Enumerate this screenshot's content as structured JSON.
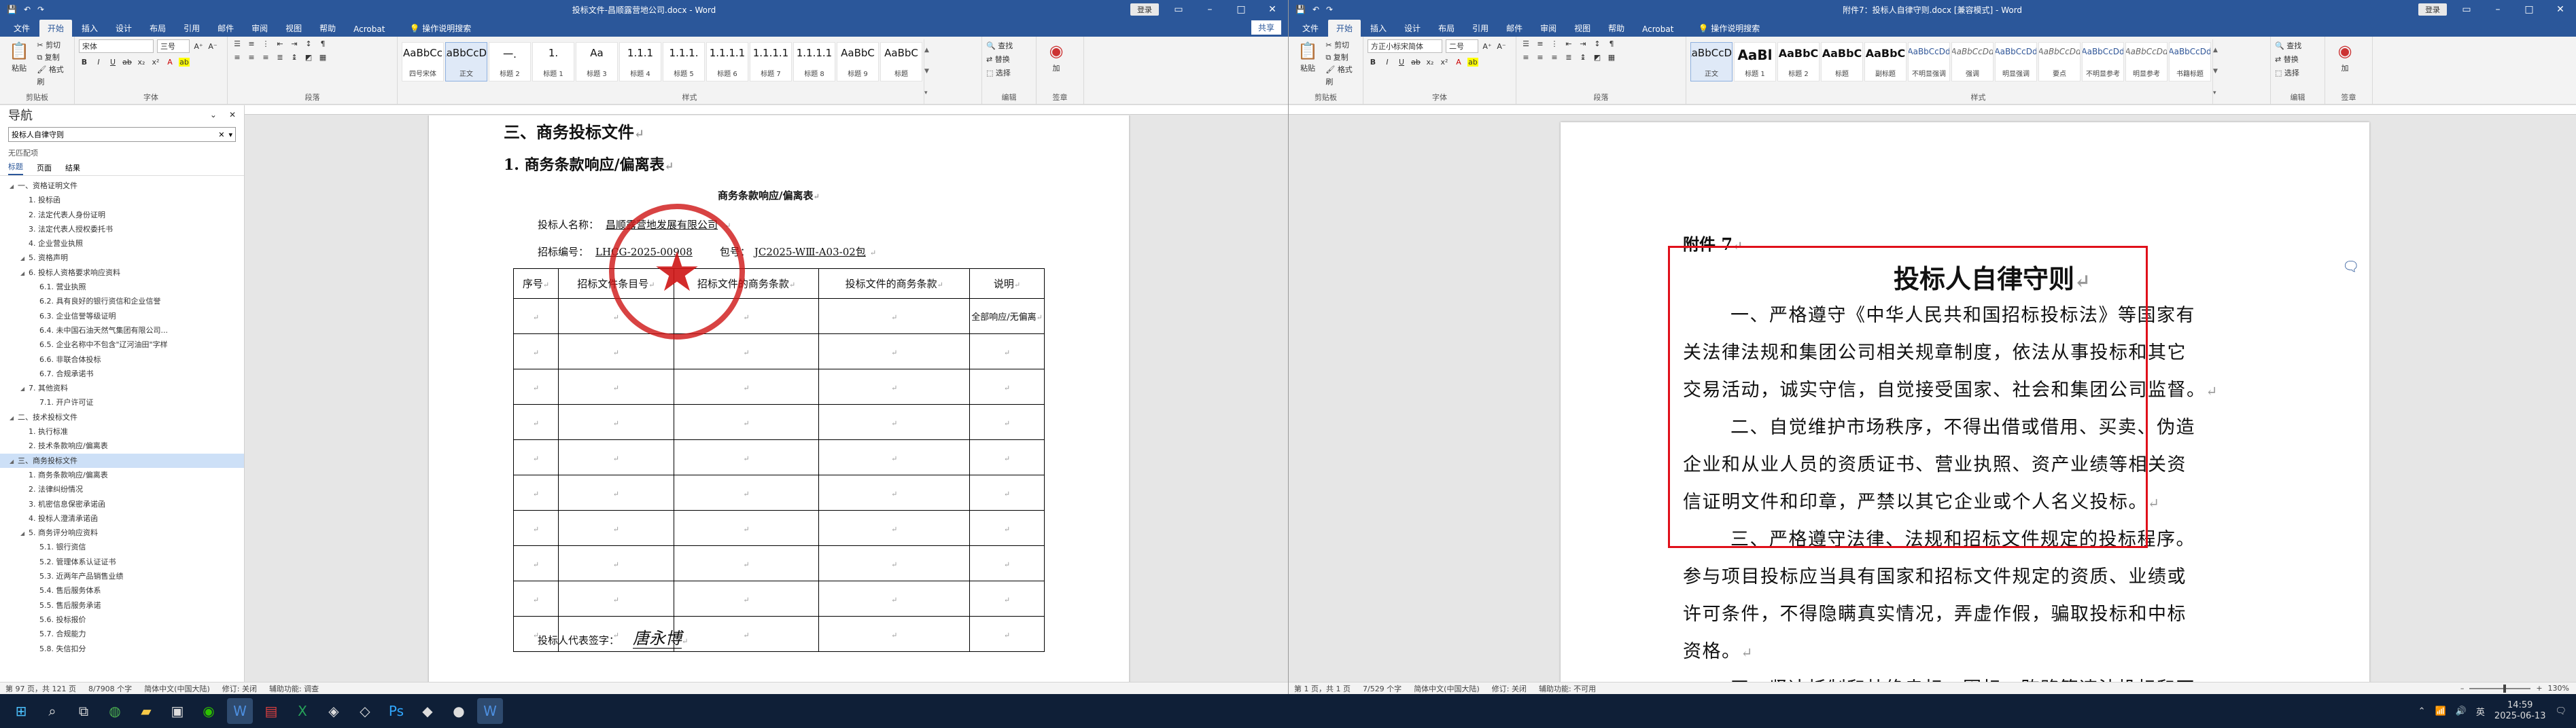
{
  "left": {
    "title": "投标文件-昌顺露营地公司.docx - Word",
    "login": "登录",
    "tabs": [
      "文件",
      "开始",
      "插入",
      "设计",
      "布局",
      "引用",
      "邮件",
      "审阅",
      "视图",
      "帮助",
      "Acrobat"
    ],
    "tell_me": "操作说明搜索",
    "share": "共享",
    "clipboard": {
      "paste": "粘贴",
      "cut": "剪切",
      "copy": "复制",
      "format_painter": "格式刷",
      "label": "剪贴板"
    },
    "font": {
      "name": "宋体",
      "size": "三号",
      "label": "字体"
    },
    "paragraph_label": "段落",
    "styles": [
      {
        "preview": "AaBbCc",
        "name": "四号宋体"
      },
      {
        "preview": "AaBbCcDd",
        "name": "正文"
      },
      {
        "preview": "一.",
        "name": "标题 2"
      },
      {
        "preview": "1.",
        "name": "标题 1"
      },
      {
        "preview": "Aa",
        "name": "标题 3"
      },
      {
        "preview": "1.1.1",
        "name": "标题 4"
      },
      {
        "preview": "1.1.1.",
        "name": "标题 5"
      },
      {
        "preview": "1.1.1.1",
        "name": "标题 6"
      },
      {
        "preview": "1.1.1.1",
        "name": "标题 7"
      },
      {
        "preview": "1.1.1.1",
        "name": "标题 8"
      },
      {
        "preview": "AaBbC",
        "name": "标题 9"
      },
      {
        "preview": "AaBbC",
        "name": "标题"
      }
    ],
    "styles_label": "样式",
    "editing": {
      "find": "查找",
      "replace": "替换",
      "select": "选择",
      "label": "编辑"
    },
    "sign": {
      "label1": "加",
      "label2": "签章"
    },
    "nav": {
      "title": "导航",
      "search_value": "投标人自律守则",
      "no_match": "无匹配项",
      "tabs": [
        "标题",
        "页面",
        "结果"
      ],
      "items": [
        "一、资格证明文件",
        "1. 投标函",
        "2. 法定代表人身份证明",
        "3. 法定代表人授权委托书",
        "4. 企业营业执照",
        "5. 资格声明",
        "6. 投标人资格要求响应资料",
        "6.1. 营业执照",
        "6.2. 具有良好的银行资信和企业信誉",
        "6.3. 企业信誉等级证明",
        "6.4. 未中国石油天然气集团有限公司...",
        "6.5. 企业名称中不包含\"辽河油田\"字样",
        "6.6. 非联合体投标",
        "6.7. 合规承诺书",
        "7. 其他资料",
        "7.1. 开户许可证",
        "二、技术投标文件",
        "1. 执行标准",
        "2. 技术条款响应/偏离表",
        "三、商务投标文件",
        "1. 商务条款响应/偏离表",
        "2. 法律纠纷情况",
        "3. 机密信息保密承诺函",
        "4. 投标人澄清承诺函",
        "5. 商务评分响应资料",
        "5.1. 银行资信",
        "5.2. 管理体系认证证书",
        "5.3. 近两年产品销售业绩",
        "5.4. 售后服务体系",
        "5.5. 售后服务承诺",
        "5.6. 投标报价",
        "5.7. 合规能力",
        "5.8. 失信扣分"
      ]
    },
    "doc": {
      "heading1": "三、商务投标文件",
      "heading2": "1. 商务条款响应/偏离表",
      "table_title": "商务条款响应/偏离表",
      "bidder_label": "投标人名称：",
      "bidder_value": "昌顺露营地发展有限公司",
      "tender_label": "招标编号：",
      "tender_value": "LHCG-2025-00908",
      "package_label": "包号：",
      "package_value": "JC2025-WⅢ-A03-02包",
      "headers": [
        "序号",
        "招标文件条目号",
        "招标文件的商务条款",
        "投标文件的商务条款",
        "说明"
      ],
      "first_note": "全部响应/无偏离",
      "rep_label": "投标人代表签字：",
      "rep_sign": "唐永博"
    },
    "status": {
      "page": "第 97 页，共 121 页",
      "words": "8/7908 个字",
      "lang": "简体中文(中国大陆)",
      "track": "修订: 关闭",
      "access": "辅助功能: 调查"
    }
  },
  "right": {
    "title": "附件7：投标人自律守则.docx [兼容模式] - Word",
    "login": "登录",
    "tabs": [
      "文件",
      "开始",
      "插入",
      "设计",
      "布局",
      "引用",
      "邮件",
      "审阅",
      "视图",
      "帮助",
      "Acrobat"
    ],
    "tell_me": "操作说明搜索",
    "font": {
      "name": "方正小标宋简体",
      "size": "二号",
      "label": "字体"
    },
    "styles": [
      {
        "preview": "AaBbCcDd",
        "name": "正文"
      },
      {
        "preview": "AaBl",
        "name": "标题 1"
      },
      {
        "preview": "AaBbC",
        "name": "标题 2"
      },
      {
        "preview": "AaBbC",
        "name": "标题"
      },
      {
        "preview": "AaBbC",
        "name": "副标题"
      },
      {
        "preview": "AaBbCcDd",
        "name": "不明显强调"
      },
      {
        "preview": "AaBbCcDd",
        "name": "强调"
      },
      {
        "preview": "AaBbCcDd",
        "name": "明显强调"
      },
      {
        "preview": "AaBbCcDd",
        "name": "要点"
      },
      {
        "preview": "AaBbCcDd",
        "name": "不明显参考"
      },
      {
        "preview": "AaBbCcDd",
        "name": "明显参考"
      },
      {
        "preview": "AaBbCcDd",
        "name": "书籍标题"
      }
    ],
    "editing": {
      "find": "查找",
      "replace": "替换",
      "select": "选择",
      "label": "编辑"
    },
    "doc": {
      "attachment": "附件 7",
      "title": "投标人自律守则",
      "lines": [
        "一、严格遵守《中华人民共和国招标投标法》等国家有",
        "关法律法规和集团公司相关规章制度，依法从事投标和其它",
        "交易活动，诚实守信，自觉接受国家、社会和集团公司监督。",
        "二、自觉维护市场秩序，不得出借或借用、买卖、伪造",
        "企业和从业人员的资质证书、营业执照、资产业绩等相关资",
        "信证明文件和印章，严禁以其它企业或个人名义投标。",
        "三、严格遵守法律、法规和招标文件规定的投标程序。",
        "参与项目投标应当具有国家和招标文件规定的资质、业绩或",
        "许可条件，不得隐瞒真实情况，弄虚作假，骗取投标和中标",
        "资格。",
        "四、坚决抵制和杜绝串标、围标、贿赂等违法投标和不"
      ]
    },
    "status": {
      "page": "第 1 页，共 1 页",
      "words": "7/529 个字",
      "lang": "简体中文(中国大陆)",
      "track": "修订: 关闭",
      "access": "辅助功能: 不可用",
      "zoom": "130%"
    }
  },
  "taskbar": {
    "time": "14:59",
    "date": "2025-06-13",
    "lang": "英"
  }
}
